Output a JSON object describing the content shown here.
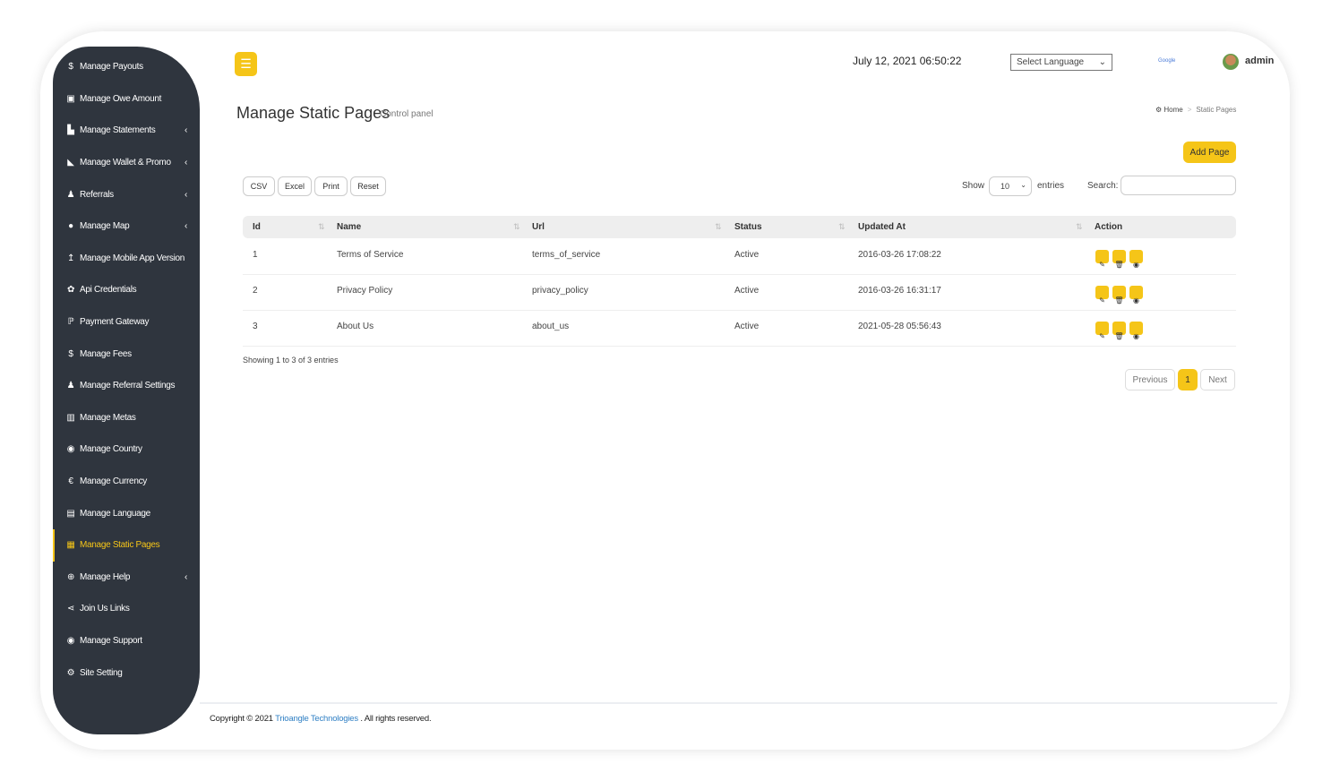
{
  "sidebar": {
    "items": [
      {
        "label": "Manage Payouts",
        "icon": "dollar-icon",
        "glyph": "$",
        "chev": true
      },
      {
        "label": "Manage Owe Amount",
        "icon": "money-icon",
        "glyph": "▣",
        "chev": false
      },
      {
        "label": "Manage Statements",
        "icon": "area-chart-icon",
        "glyph": "▙",
        "chev": true
      },
      {
        "label": "Manage Wallet & Promo",
        "icon": "wallet-icon",
        "glyph": "◣",
        "chev": true
      },
      {
        "label": "Referrals",
        "icon": "users-icon",
        "glyph": "♟",
        "chev": true
      },
      {
        "label": "Manage Map",
        "icon": "map-marker-icon",
        "glyph": "●",
        "chev": true
      },
      {
        "label": "Manage Mobile App Version",
        "icon": "upload-icon",
        "glyph": "↥",
        "chev": false
      },
      {
        "label": "Api Credentials",
        "icon": "gear-icon",
        "glyph": "✿",
        "chev": false
      },
      {
        "label": "Payment Gateway",
        "icon": "paypal-icon",
        "glyph": "ℙ",
        "chev": false
      },
      {
        "label": "Manage Fees",
        "icon": "dollar-icon",
        "glyph": "$",
        "chev": false
      },
      {
        "label": "Manage Referral Settings",
        "icon": "users-icon",
        "glyph": "♟",
        "chev": false
      },
      {
        "label": "Manage Metas",
        "icon": "bar-chart-icon",
        "glyph": "▥",
        "chev": false
      },
      {
        "label": "Manage Country",
        "icon": "globe-icon",
        "glyph": "◉",
        "chev": false
      },
      {
        "label": "Manage Currency",
        "icon": "euro-icon",
        "glyph": "€",
        "chev": false
      },
      {
        "label": "Manage Language",
        "icon": "language-icon",
        "glyph": "▤",
        "chev": false
      },
      {
        "label": "Manage Static Pages",
        "icon": "newspaper-icon",
        "glyph": "▦",
        "chev": false,
        "active": true
      },
      {
        "label": "Manage Help",
        "icon": "life-ring-icon",
        "glyph": "⊕",
        "chev": true
      },
      {
        "label": "Join Us Links",
        "icon": "share-icon",
        "glyph": "⋖",
        "chev": false
      },
      {
        "label": "Manage Support",
        "icon": "globe-icon",
        "glyph": "◉",
        "chev": false
      },
      {
        "label": "Site Setting",
        "icon": "gears-icon",
        "glyph": "⚙",
        "chev": false
      }
    ]
  },
  "header": {
    "datetime": "July 12, 2021 06:50:22",
    "language_select": "Select Language",
    "google_label": "Google",
    "user": "admin"
  },
  "page": {
    "title": "Manage Static Pages",
    "subtitle": "Control panel",
    "breadcrumb": {
      "home": "Home",
      "current": "Static Pages"
    },
    "add_button": "Add Page"
  },
  "toolbar": {
    "buttons": [
      "CSV",
      "Excel",
      "Print",
      "Reset"
    ],
    "show_label": "Show",
    "page_length": "10",
    "entries_label": "entries",
    "search_label": "Search:",
    "search_value": ""
  },
  "table": {
    "columns": [
      "Id",
      "Name",
      "Url",
      "Status",
      "Updated At",
      "Action"
    ],
    "rows": [
      {
        "id": "1",
        "name": "Terms of Service",
        "url": "terms_of_service",
        "status": "Active",
        "updated": "2016-03-26 17:08:22"
      },
      {
        "id": "2",
        "name": "Privacy Policy",
        "url": "privacy_policy",
        "status": "Active",
        "updated": "2016-03-26 16:31:17"
      },
      {
        "id": "3",
        "name": "About Us",
        "url": "about_us",
        "status": "Active",
        "updated": "2021-05-28 05:56:43"
      }
    ]
  },
  "info": "Showing 1 to 3 of 3 entries",
  "pagination": {
    "previous": "Previous",
    "current": "1",
    "next": "Next"
  },
  "footer": {
    "prefix": "Copyright © 2021",
    "company": "Trioangle Technologies",
    "suffix": ". All rights reserved."
  },
  "colors": {
    "accent": "#f5c518",
    "sidebar": "#2f353e",
    "link": "#2f7fc4"
  }
}
